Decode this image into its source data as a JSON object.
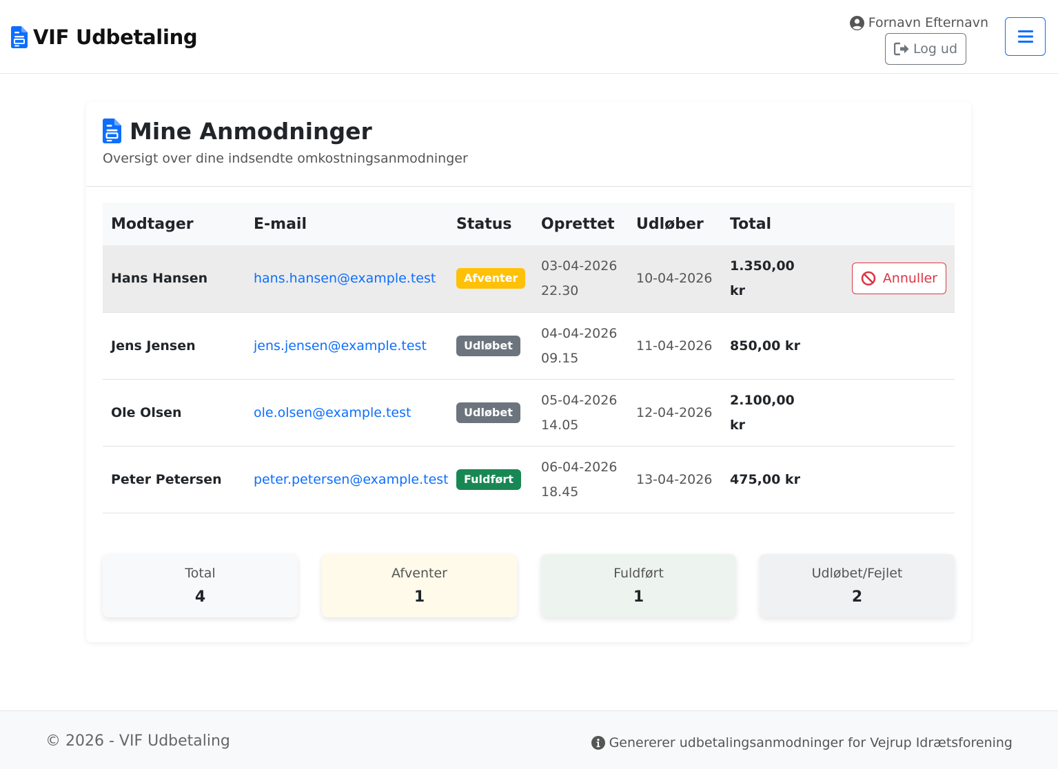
{
  "header": {
    "brand": "VIF Udbetaling",
    "user_name": "Fornavn Efternavn",
    "logout_label": "Log ud"
  },
  "main": {
    "title": "Mine Anmodninger",
    "subtitle": "Oversigt over dine indsendte omkostningsanmodninger",
    "table": {
      "columns": [
        "Modtager",
        "E-mail",
        "Status",
        "Oprettet",
        "Udløber",
        "Total"
      ],
      "rows": [
        {
          "name": "Hans Hansen",
          "email": "hans.hansen@example.test",
          "status": "Afventer",
          "status_kind": "warning",
          "created_date": "03-04-2026",
          "created_time": "22.30",
          "expires": "10-04-2026",
          "total_line1": "1.350,00",
          "total_line2": "kr",
          "action": "Annuller"
        },
        {
          "name": "Jens Jensen",
          "email": "jens.jensen@example.test",
          "status": "Udløbet",
          "status_kind": "secondary",
          "created_date": "04-04-2026",
          "created_time": "09.15",
          "expires": "11-04-2026",
          "total_line1": "850,00 kr",
          "total_line2": "",
          "action": ""
        },
        {
          "name": "Ole Olsen",
          "email": "ole.olsen@example.test",
          "status": "Udløbet",
          "status_kind": "secondary",
          "created_date": "05-04-2026",
          "created_time": "14.05",
          "expires": "12-04-2026",
          "total_line1": "2.100,00",
          "total_line2": "kr",
          "action": ""
        },
        {
          "name": "Peter Petersen",
          "email": "peter.petersen@example.test",
          "status": "Fuldført",
          "status_kind": "success",
          "created_date": "06-04-2026",
          "created_time": "18.45",
          "expires": "13-04-2026",
          "total_line1": "475,00 kr",
          "total_line2": "",
          "action": ""
        }
      ]
    },
    "stats": [
      {
        "label": "Total",
        "value": "4",
        "bg": "#f8f9fa"
      },
      {
        "label": "Afventer",
        "value": "1",
        "bg": "#fffaea"
      },
      {
        "label": "Fuldført",
        "value": "1",
        "bg": "#edf4ef"
      },
      {
        "label": "Udløbet/Fejlet",
        "value": "2",
        "bg": "#f0f1f2"
      }
    ]
  },
  "footer": {
    "copyright": "© 2026 - VIF Udbetaling",
    "info": "Genererer udbetalingsanmodninger for Vejrup Idrætsforening"
  },
  "colors": {
    "primary": "#0d6efd",
    "danger": "#dc3545",
    "warning": "#ffc107",
    "secondary": "#6c757d",
    "success": "#198754"
  },
  "icons": {
    "brand": "file-document-icon",
    "user": "user-circle-icon",
    "logout": "sign-out-icon",
    "menu": "hamburger-menu-icon",
    "cancel": "ban-icon",
    "info": "info-circle-icon"
  }
}
